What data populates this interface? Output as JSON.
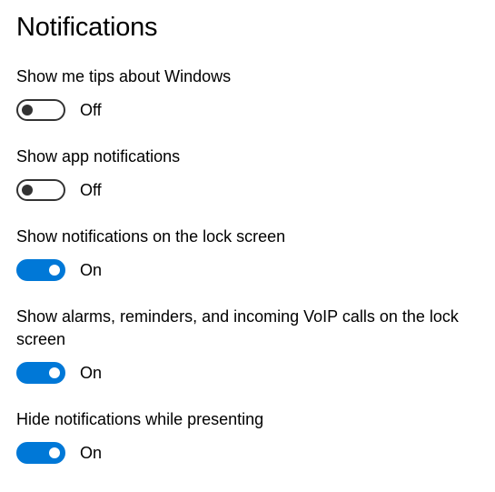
{
  "page": {
    "title": "Notifications"
  },
  "settings": [
    {
      "label": "Show me tips about Windows",
      "state": "Off",
      "enabled": false
    },
    {
      "label": "Show app notifications",
      "state": "Off",
      "enabled": false
    },
    {
      "label": "Show notifications on the lock screen",
      "state": "On",
      "enabled": true
    },
    {
      "label": "Show alarms, reminders, and incoming VoIP calls on the lock screen",
      "state": "On",
      "enabled": true
    },
    {
      "label": "Hide notifications while presenting",
      "state": "On",
      "enabled": true
    }
  ],
  "colors": {
    "accent": "#0078d7",
    "toggle_off_border": "#333333",
    "text": "#000000",
    "background": "#ffffff"
  }
}
